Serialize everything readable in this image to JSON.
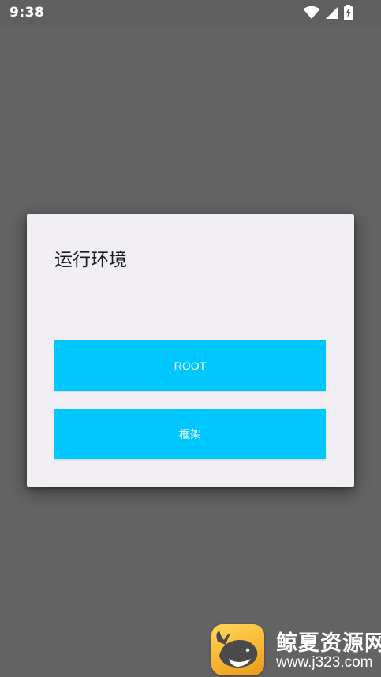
{
  "status_bar": {
    "time": "9:38",
    "icons": [
      "wifi-icon",
      "cell-signal-icon",
      "battery-charging-icon"
    ]
  },
  "dialog": {
    "title": "运行环境",
    "buttons": {
      "root_label": "ROOT",
      "framework_label": "框架"
    }
  },
  "watermark": {
    "title": "鲸夏资源网",
    "url": "www.j323.com"
  },
  "colors": {
    "scrim": "#636363",
    "dialog_background": "#f1eff3",
    "button_accent": "#00c8ff",
    "button_text": "#ffffff"
  }
}
